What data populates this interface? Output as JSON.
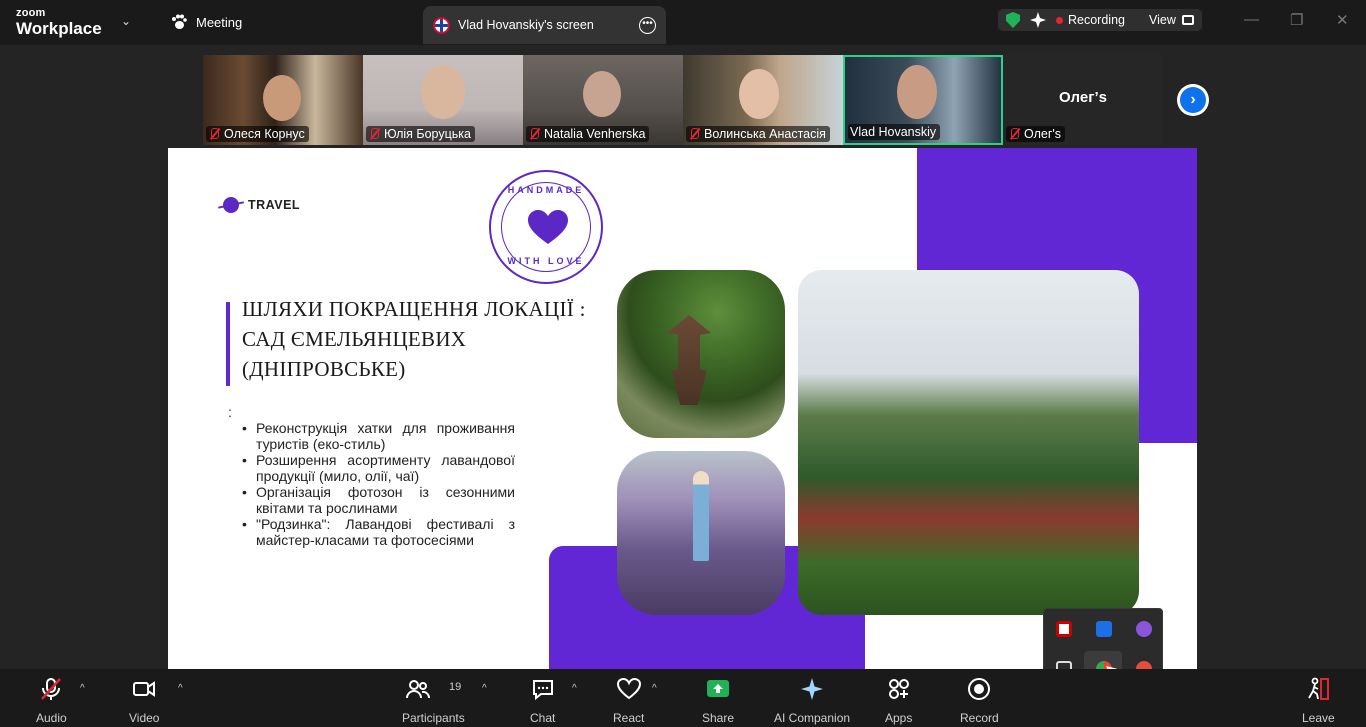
{
  "app": {
    "brand_line1": "zoom",
    "brand_line2": "Workplace",
    "meeting_tab": "Meeting",
    "screen_tab": "Vlad Hovanskiy's screen",
    "recording": "Recording",
    "view": "View",
    "next_page": "›"
  },
  "participants": [
    {
      "name": "Олеся Корнус",
      "muted": true
    },
    {
      "name": "Юлія Боруцька",
      "muted": true
    },
    {
      "name": "Natalia Venherska",
      "muted": true
    },
    {
      "name": "Волинська Анастасія",
      "muted": true
    },
    {
      "name": "Vlad Hovanskiy",
      "muted": false,
      "active": true
    },
    {
      "name": "Олег's",
      "display_name": "Олег’s",
      "muted": true
    }
  ],
  "slide": {
    "logo": "TRAVEL",
    "badge_top": "HANDMADE",
    "badge_bottom": "WITH LOVE",
    "heading": "ШЛЯХИ ПОКРАЩЕННЯ ЛОКАЦІЇ : САД ЄМЕЛЬЯНЦЕВИХ (ДНІПРОВСЬКЕ)",
    "colon": ":",
    "bullets": [
      "Реконструкція хатки для проживання туристів (еко-стиль)",
      "Розширення асортименту лавандової продукції (мило, олії, чаї)",
      "Організація фотозон із сезонними квітами та рослинами",
      "\"Родзинка\": Лавандові фестивалі з майстер-класами та фотосесіями"
    ],
    "accent_color": "#6127d4"
  },
  "toolbar": {
    "audio": "Audio",
    "video": "Video",
    "participants": "Participants",
    "participants_count": "19",
    "chat": "Chat",
    "react": "React",
    "share": "Share",
    "ai_companion": "AI Companion",
    "apps": "Apps",
    "record": "Record",
    "leave": "Leave"
  }
}
